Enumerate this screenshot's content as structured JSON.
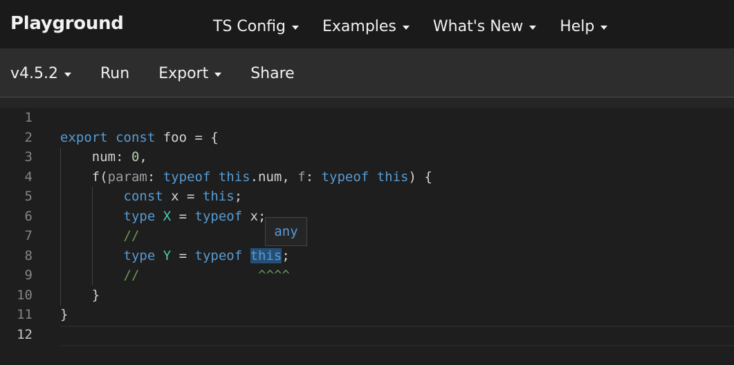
{
  "topnav": {
    "brand": "Playground",
    "items": [
      {
        "label": "TS Config"
      },
      {
        "label": "Examples"
      },
      {
        "label": "What's New"
      },
      {
        "label": "Help"
      }
    ]
  },
  "toolbar": {
    "version": "v4.5.2",
    "run": "Run",
    "export": "Export",
    "share": "Share"
  },
  "editor": {
    "line_numbers": [
      "1",
      "2",
      "3",
      "4",
      "5",
      "6",
      "7",
      "8",
      "9",
      "10",
      "11",
      "12"
    ],
    "active_line": "12",
    "lines": {
      "l2": {
        "export": "export",
        "const": "const",
        "name": " foo = {"
      },
      "l3": {
        "prop": "num: ",
        "value": "0",
        "comma": ","
      },
      "l4": {
        "fn": "f(",
        "param": "param",
        "colon1": ": ",
        "typeof1": "typeof",
        "sp1": " ",
        "this1": "this",
        "rest1": ".num, ",
        "f": "f",
        "colon2": ": ",
        "typeof2": "typeof",
        "sp2": " ",
        "this2": "this",
        "end": ") {"
      },
      "l5": {
        "const": "const",
        "mid": " x = ",
        "this": "this",
        "end": ";"
      },
      "l6": {
        "type": "type",
        "sp": " ",
        "name": "X",
        "mid": " = ",
        "typeof": "typeof",
        "rest": " x;"
      },
      "l7": {
        "comment": "//"
      },
      "l8": {
        "type": "type",
        "sp": " ",
        "name": "Y",
        "mid": " = ",
        "typeof": "typeof",
        "sp2": " ",
        "this": "this",
        "end": ";"
      },
      "l9": {
        "comment": "//",
        "carets": "^^^^"
      },
      "l10": {
        "brace": "}"
      },
      "l11": {
        "brace": "}"
      }
    },
    "hover_tooltip": "any"
  }
}
